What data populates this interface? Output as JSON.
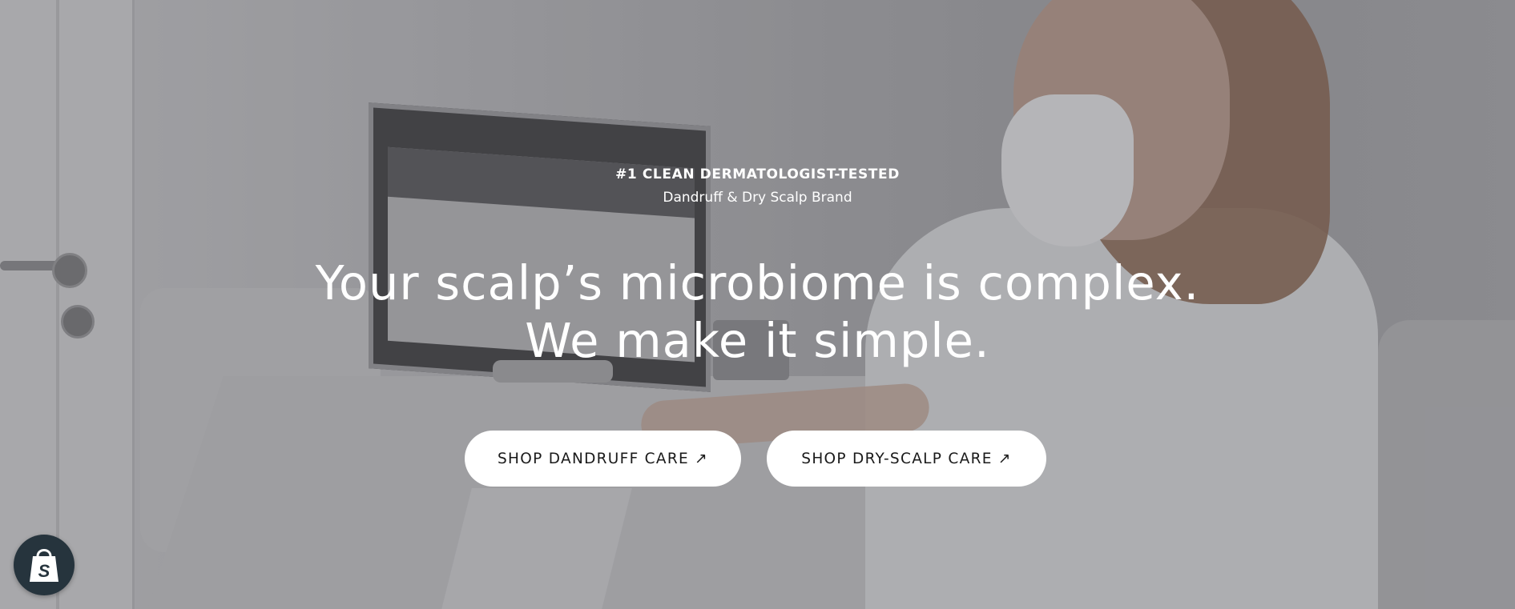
{
  "hero": {
    "eyebrow": "#1 CLEAN DERMATOLOGIST-TESTED",
    "subline": "Dandruff & Dry Scalp Brand",
    "headline_line1": "Your scalp’s microbiome is complex.",
    "headline_line2": "We make it simple.",
    "background_image": "dermatologist-at-computer-photo"
  },
  "buttons": {
    "shop_dandruff": "SHOP DANDRUFF CARE ↗",
    "shop_dry_scalp": "SHOP DRY-SCALP CARE ↗"
  },
  "widgets": {
    "shopify_badge_icon": "shopify-bag-icon"
  },
  "colors": {
    "button_bg": "#ffffff",
    "button_text": "#1a1a1a",
    "text": "#ffffff",
    "badge_bg": "#26343d"
  }
}
